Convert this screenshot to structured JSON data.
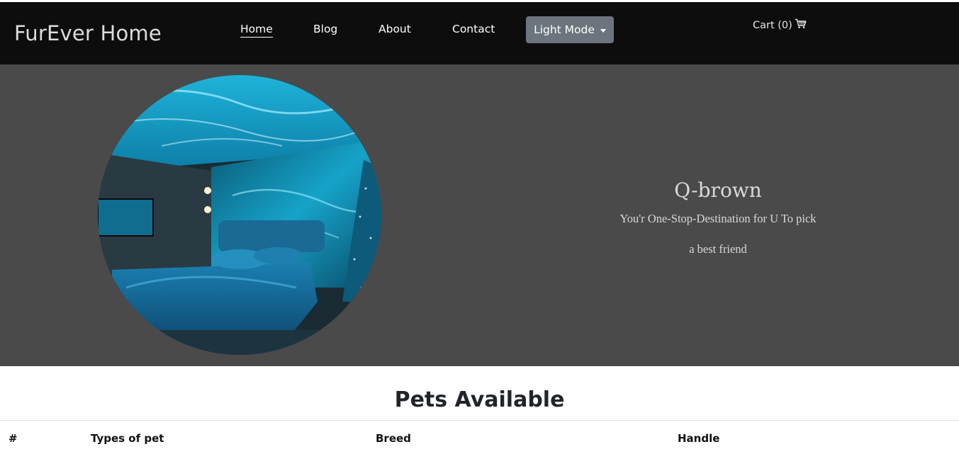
{
  "navbar": {
    "brand": "FurEver Home",
    "links": [
      {
        "label": "Home",
        "active": true
      },
      {
        "label": "Blog",
        "active": false
      },
      {
        "label": "About",
        "active": false
      },
      {
        "label": "Contact",
        "active": false
      }
    ],
    "mode_button": "Light Mode",
    "cart": {
      "label": "Cart (0)",
      "icon": "cart-icon"
    }
  },
  "hero": {
    "image": "circular-bedroom-photo",
    "title": "Q-brown",
    "subtitle_line1": "You'r One-Stop-Destination for U To pick",
    "subtitle_line2": "a best friend"
  },
  "pets": {
    "heading": "Pets Available",
    "columns": [
      "#",
      "Types of pet",
      "Breed",
      "Handle"
    ]
  },
  "colors": {
    "navbar_bg": "#0d0d0d",
    "hero_bg": "#4a4a4a",
    "button_bg": "#6c757d"
  }
}
